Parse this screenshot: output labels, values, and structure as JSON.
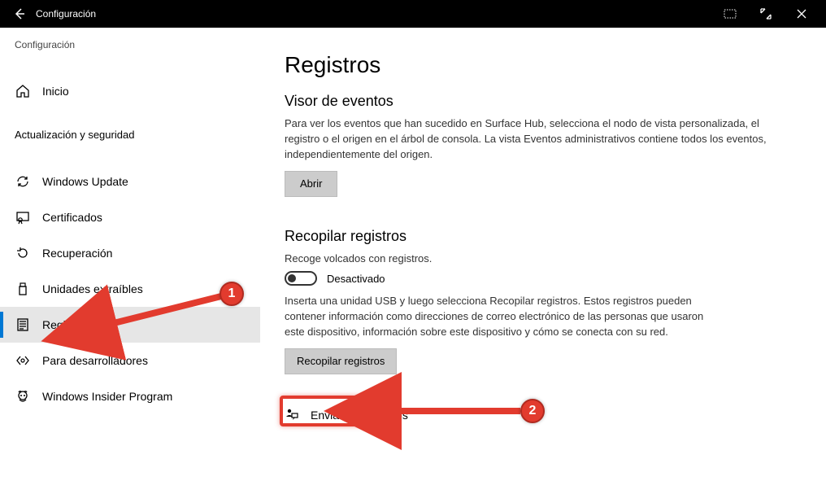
{
  "titlebar": {
    "title": "Configuración"
  },
  "sidebar": {
    "breadcrumb": "Configuración",
    "home_label": "Inicio",
    "section_label": "Actualización y seguridad",
    "items": [
      {
        "label": "Windows Update"
      },
      {
        "label": "Certificados"
      },
      {
        "label": "Recuperación"
      },
      {
        "label": "Unidades extraíbles"
      },
      {
        "label": "Registros"
      },
      {
        "label": "Para desarrolladores"
      },
      {
        "label": "Windows Insider Program"
      }
    ]
  },
  "main": {
    "page_title": "Registros",
    "section_viewer_title": "Visor de eventos",
    "viewer_desc": "Para ver los eventos que han sucedido en Surface Hub, selecciona el nodo de vista personalizada, el registro o el origen en el árbol de consola. La vista Eventos administrativos contiene todos los eventos, independientemente del origen.",
    "open_btn": "Abrir",
    "section_collect_title": "Recopilar registros",
    "collect_toggle_caption": "Recoge volcados con registros.",
    "collect_toggle_state": "Desactivado",
    "collect_desc": "Inserta una unidad USB y luego selecciona Recopilar registros. Estos registros pueden contener información como direcciones de correo electrónico de las personas que usaron este dispositivo, información sobre este dispositivo y cómo se conecta con su red.",
    "collect_btn": "Recopilar registros",
    "feedback_label": "Enviar comentarios"
  },
  "annotations": {
    "callout1": "1",
    "callout2": "2"
  }
}
